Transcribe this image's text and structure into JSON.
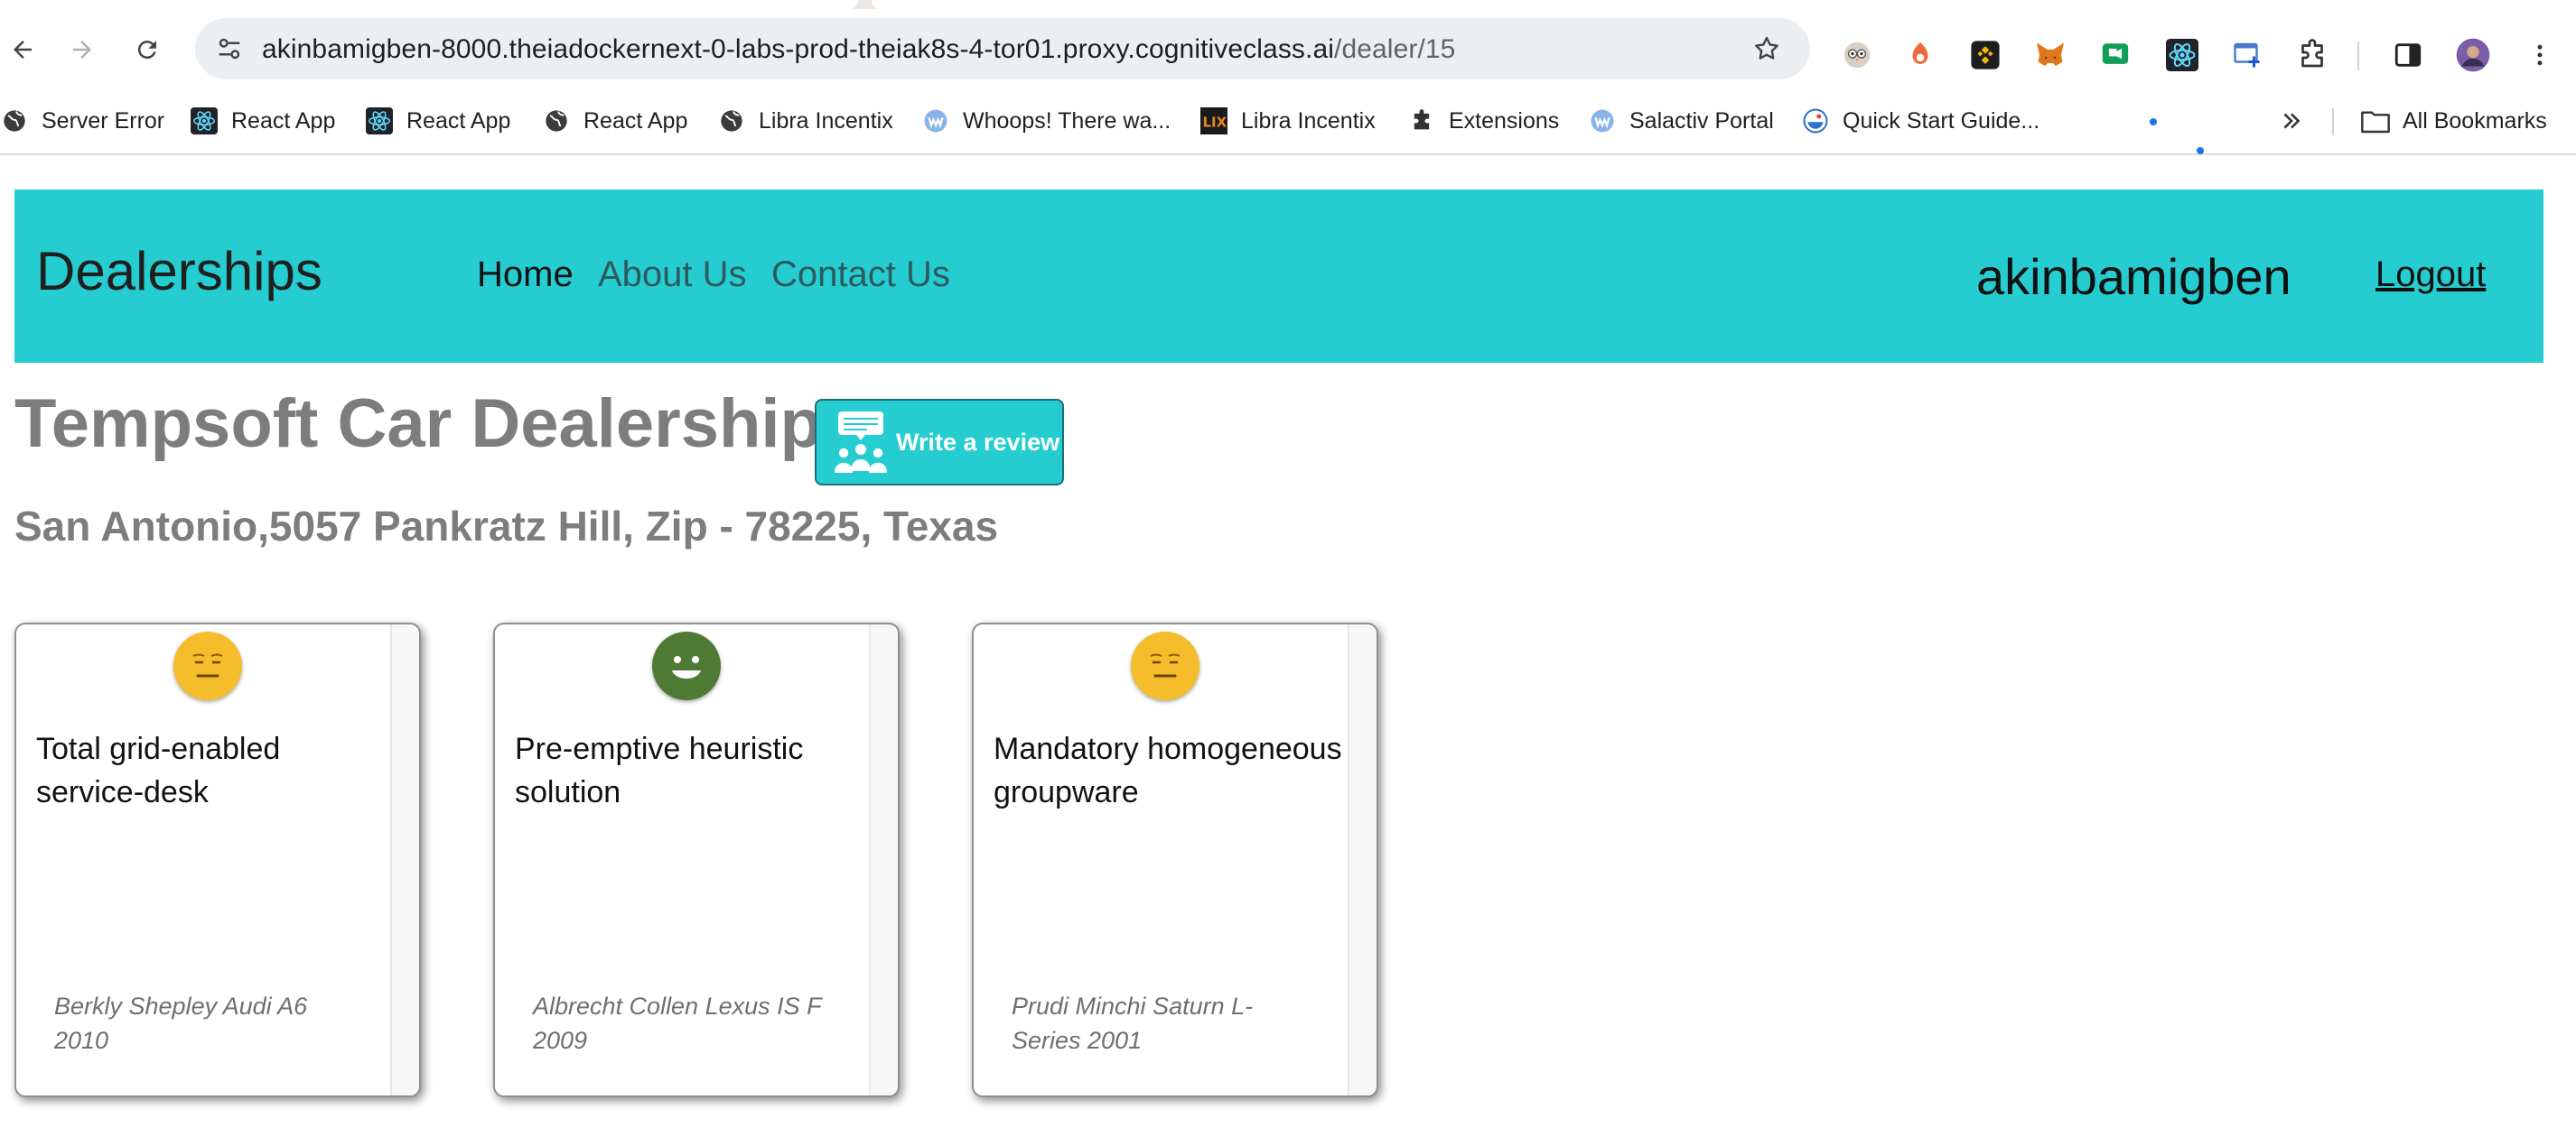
{
  "browser": {
    "url_host": "akinbamigben-8000.theiadockernext-0-labs-prod-theiak8s-4-tor01.proxy.cognitiveclass.ai",
    "url_path": "/dealer/15",
    "bookmarks": [
      {
        "label": "Server Error",
        "icon": "globe-icon"
      },
      {
        "label": "React App",
        "icon": "react-icon"
      },
      {
        "label": "React App",
        "icon": "react-icon"
      },
      {
        "label": "React App",
        "icon": "globe-icon"
      },
      {
        "label": "Libra Incentix",
        "icon": "globe-icon"
      },
      {
        "label": "Whoops! There wa...",
        "icon": "whoops-icon"
      },
      {
        "label": "Libra Incentix",
        "icon": "lix-icon"
      },
      {
        "label": "Extensions",
        "icon": "puzzle-icon"
      },
      {
        "label": "Salactiv Portal",
        "icon": "whoops-icon"
      },
      {
        "label": "Quick Start Guide...",
        "icon": "docker-icon"
      }
    ],
    "all_bookmarks": "All Bookmarks"
  },
  "navbar": {
    "brand": "Dealerships",
    "links": [
      "Home",
      "About Us",
      "Contact Us"
    ],
    "username": "akinbamigben",
    "logout": "Logout"
  },
  "dealer": {
    "name": "Tempsoft Car Dealership",
    "address": "San Antonio,5057 Pankratz Hill, Zip - 78225, Texas",
    "review_button": "Write a review"
  },
  "reviews": [
    {
      "sentiment": "neutral",
      "text": "Total grid-enabled service-desk",
      "car": "Berkly Shepley Audi A6 2010"
    },
    {
      "sentiment": "positive",
      "text": "Pre-emptive heuristic solution",
      "car": "Albrecht Collen Lexus IS F 2009"
    },
    {
      "sentiment": "neutral",
      "text": "Mandatory homogeneous groupware",
      "car": "Prudi Minchi Saturn L-Series 2001"
    }
  ],
  "colors": {
    "navbar": "#25cdd1",
    "neutral_face": "#f5bd2b",
    "positive_face": "#4f7a34"
  }
}
